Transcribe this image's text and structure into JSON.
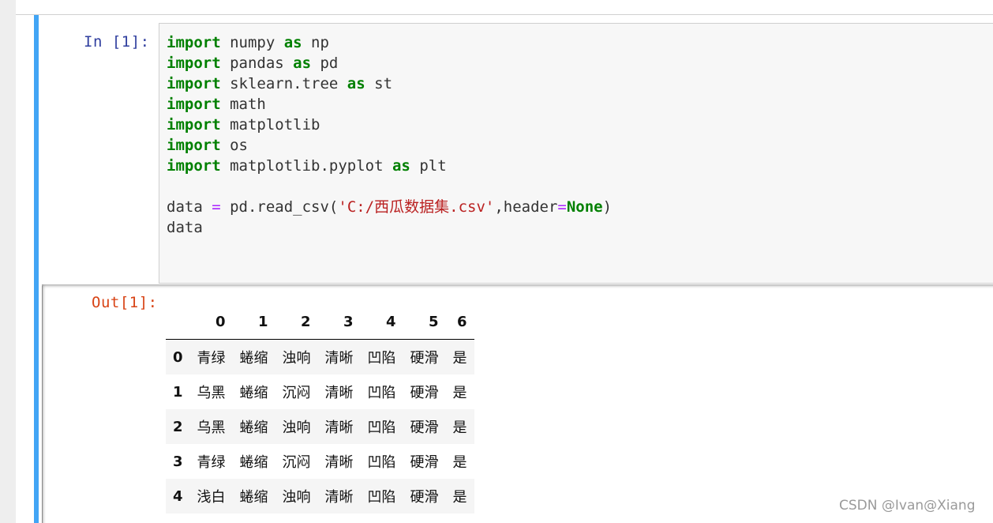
{
  "cell": {
    "in_prompt": "In  [1]:",
    "out_prompt": "Out[1]:",
    "code_lines": [
      [
        {
          "t": "import",
          "c": "kw"
        },
        {
          "t": " numpy "
        },
        {
          "t": "as",
          "c": "kw"
        },
        {
          "t": " np"
        }
      ],
      [
        {
          "t": "import",
          "c": "kw"
        },
        {
          "t": " pandas "
        },
        {
          "t": "as",
          "c": "kw"
        },
        {
          "t": " pd"
        }
      ],
      [
        {
          "t": "import",
          "c": "kw"
        },
        {
          "t": " sklearn.tree "
        },
        {
          "t": "as",
          "c": "kw"
        },
        {
          "t": " st"
        }
      ],
      [
        {
          "t": "import",
          "c": "kw"
        },
        {
          "t": " math"
        }
      ],
      [
        {
          "t": "import",
          "c": "kw"
        },
        {
          "t": " matplotlib"
        }
      ],
      [
        {
          "t": "import",
          "c": "kw"
        },
        {
          "t": " os"
        }
      ],
      [
        {
          "t": "import",
          "c": "kw"
        },
        {
          "t": " matplotlib.pyplot "
        },
        {
          "t": "as",
          "c": "kw"
        },
        {
          "t": " plt"
        }
      ],
      [],
      [
        {
          "t": "data "
        },
        {
          "t": "=",
          "c": "op"
        },
        {
          "t": " pd.read_csv("
        },
        {
          "t": "'C:/西瓜数据集.csv'",
          "c": "str"
        },
        {
          "t": ",header"
        },
        {
          "t": "=",
          "c": "op"
        },
        {
          "t": "None",
          "c": "kw"
        },
        {
          "t": ")"
        }
      ],
      [
        {
          "t": "data"
        }
      ]
    ]
  },
  "dataframe": {
    "columns": [
      "0",
      "1",
      "2",
      "3",
      "4",
      "5",
      "6"
    ],
    "rows": [
      {
        "index": "0",
        "values": [
          "青绿",
          "蜷缩",
          "浊响",
          "清晰",
          "凹陷",
          "硬滑",
          "是"
        ]
      },
      {
        "index": "1",
        "values": [
          "乌黑",
          "蜷缩",
          "沉闷",
          "清晰",
          "凹陷",
          "硬滑",
          "是"
        ]
      },
      {
        "index": "2",
        "values": [
          "乌黑",
          "蜷缩",
          "浊响",
          "清晰",
          "凹陷",
          "硬滑",
          "是"
        ]
      },
      {
        "index": "3",
        "values": [
          "青绿",
          "蜷缩",
          "沉闷",
          "清晰",
          "凹陷",
          "硬滑",
          "是"
        ]
      },
      {
        "index": "4",
        "values": [
          "浅白",
          "蜷缩",
          "浊响",
          "清晰",
          "凹陷",
          "硬滑",
          "是"
        ]
      }
    ]
  },
  "watermark": "CSDN @Ivan@Xiang",
  "colors": {
    "cell_border": "#42a5f5",
    "in_prompt": "#303f9f",
    "out_prompt": "#d84315",
    "keyword": "#008000",
    "operator": "#aa22ff",
    "string": "#ba2121"
  }
}
